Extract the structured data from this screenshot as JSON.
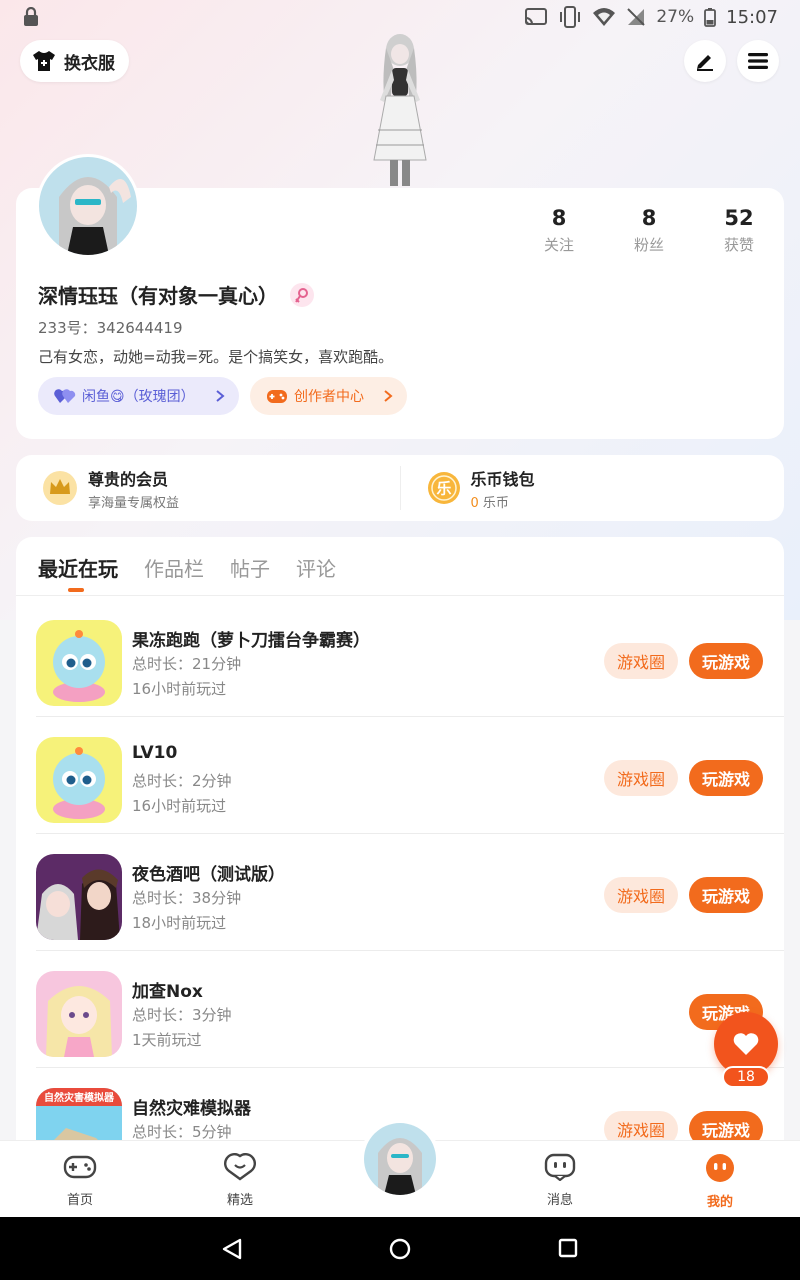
{
  "status_bar": {
    "battery": "27%",
    "time": "15:07"
  },
  "header": {
    "outfit_label": "换衣服"
  },
  "profile": {
    "stats": [
      {
        "num": "8",
        "label": "关注"
      },
      {
        "num": "8",
        "label": "粉丝"
      },
      {
        "num": "52",
        "label": "获赞"
      }
    ],
    "nickname": "深情珏珏（有对象一真心）",
    "uid": "233号：342644419",
    "bio": "己有女恋，动她=动我=死。是个搞笑女，喜欢跑酷。",
    "chips": {
      "group": "闲鱼😋（玫瑰团）",
      "creator": "创作者中心"
    }
  },
  "vip": {
    "member_title": "尊贵的会员",
    "member_sub": "享海量专属权益",
    "wallet_title": "乐币钱包",
    "wallet_num": "0",
    "wallet_unit": "乐币",
    "coin_glyph": "乐"
  },
  "tabs": [
    "最近在玩",
    "作品栏",
    "帖子",
    "评论"
  ],
  "games": [
    {
      "name": "果冻跑跑（萝卜刀擂台争霸赛）",
      "duration": "总时长：21分钟",
      "last": "16小时前玩过"
    },
    {
      "name": "LV10",
      "duration": "总时长：2分钟",
      "last": "16小时前玩过"
    },
    {
      "name": "夜色酒吧（测试版）",
      "duration": "总时长：38分钟",
      "last": "18小时前玩过"
    },
    {
      "name": "加查Nox",
      "duration": "总时长：3分钟",
      "last": "1天前玩过"
    },
    {
      "name": "自然灾难模拟器",
      "duration": "总时长：5分钟",
      "last": "",
      "icon_text": "自然灾害模拟器"
    }
  ],
  "buttons": {
    "circle": "游戏圈",
    "play": "玩游戏"
  },
  "fab": {
    "count": "18"
  },
  "nav": {
    "home": "首页",
    "featured": "精选",
    "messages": "消息",
    "mine": "我的"
  },
  "colors": {
    "accent": "#f26b1d",
    "purple": "#5b5fd6"
  }
}
